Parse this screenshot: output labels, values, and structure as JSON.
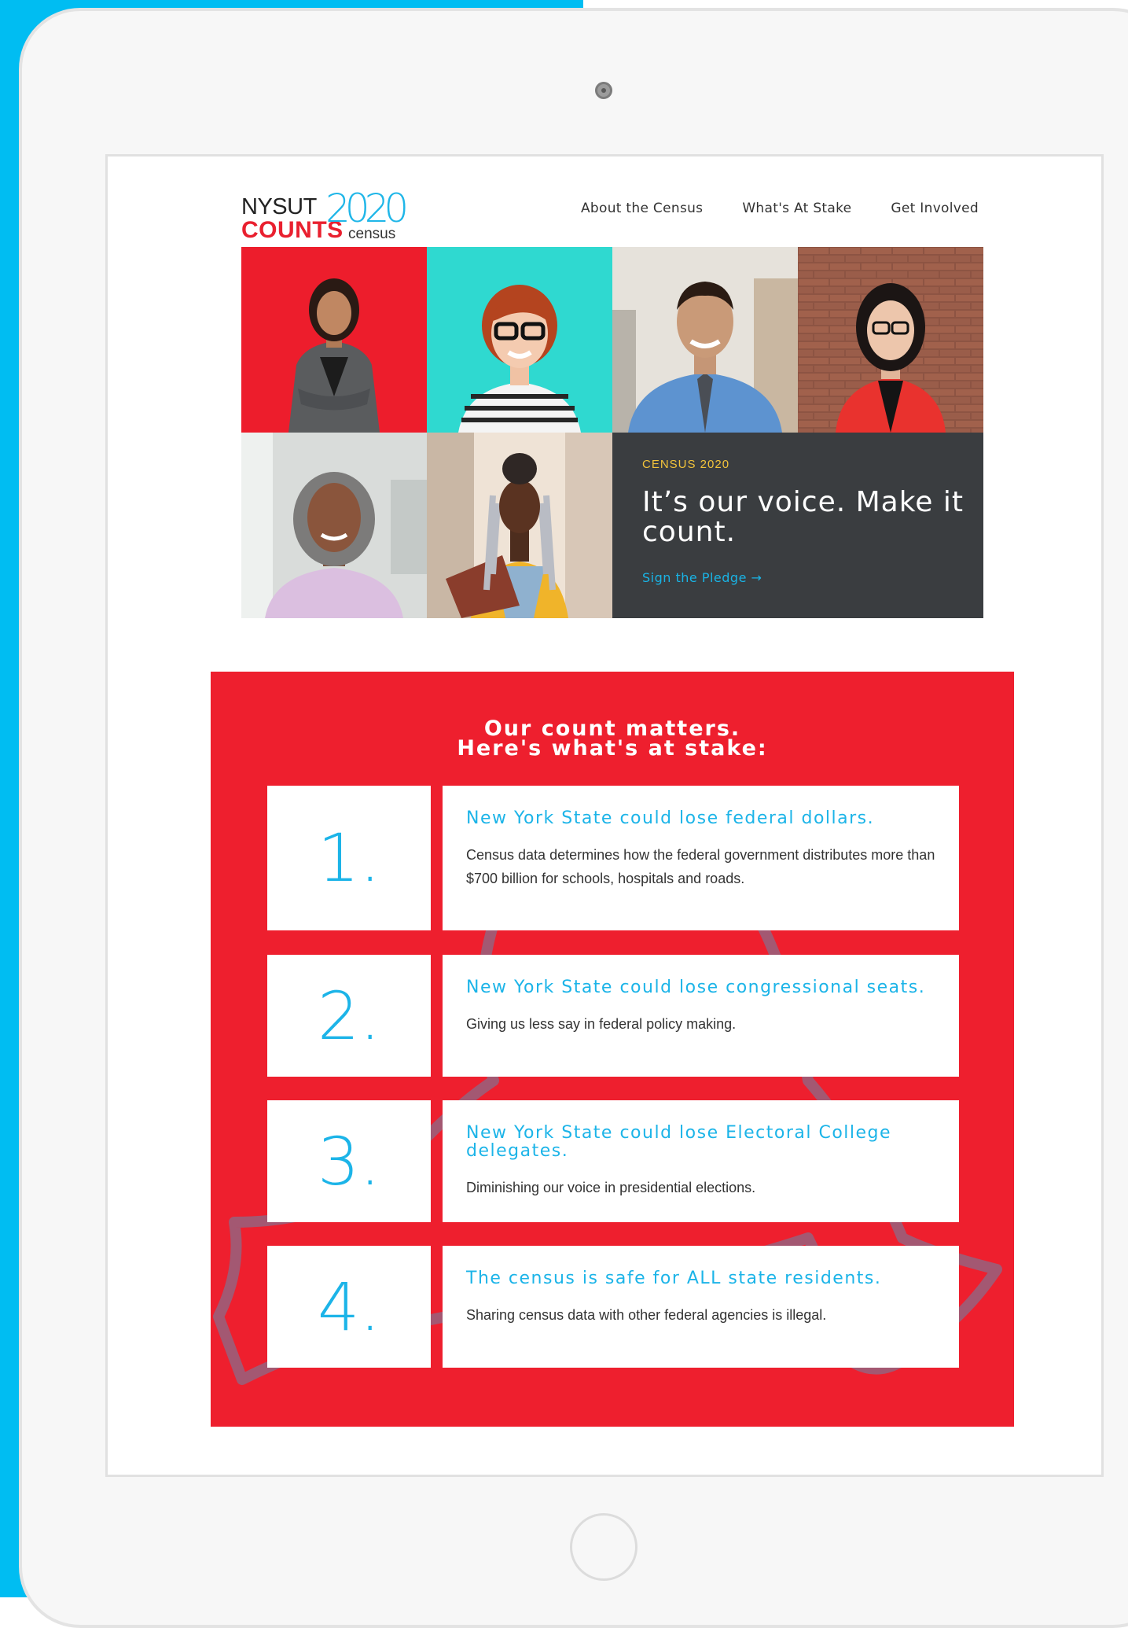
{
  "logo": {
    "line1": "NYSUT",
    "line2": "COUNTS",
    "year": "2020",
    "sub": "census"
  },
  "nav": {
    "items": [
      "About the Census",
      "What's At Stake",
      "Get Involved"
    ]
  },
  "hero": {
    "eyebrow": "CENSUS 2020",
    "headline": "It’s our voice. Make it count.",
    "cta": "Sign the Pledge →"
  },
  "stakes": {
    "title_line1": "Our count matters.",
    "title_line2": "Here's what's at stake:",
    "items": [
      {
        "number": "1.",
        "heading": "New York State could lose federal dollars.",
        "body": "Census data determines how the federal government distributes more than $700 billion for schools, hospitals and roads."
      },
      {
        "number": "2.",
        "heading": "New York State could lose congressional seats.",
        "body": "Giving us less say in federal policy making."
      },
      {
        "number": "3.",
        "heading": "New York State could lose Electoral College delegates.",
        "body": "Diminishing our voice in presidential elections."
      },
      {
        "number": "4.",
        "heading": "The census is safe for ALL state residents.",
        "body": "Sharing census data with other federal agencies is illegal."
      }
    ]
  },
  "colors": {
    "brand_red": "#ee1f2e",
    "brand_blue": "#1cb4e8",
    "dark_tile": "#3a3d40",
    "eyebrow_yellow": "#f2c33b",
    "page_blue": "#00bdf2"
  }
}
